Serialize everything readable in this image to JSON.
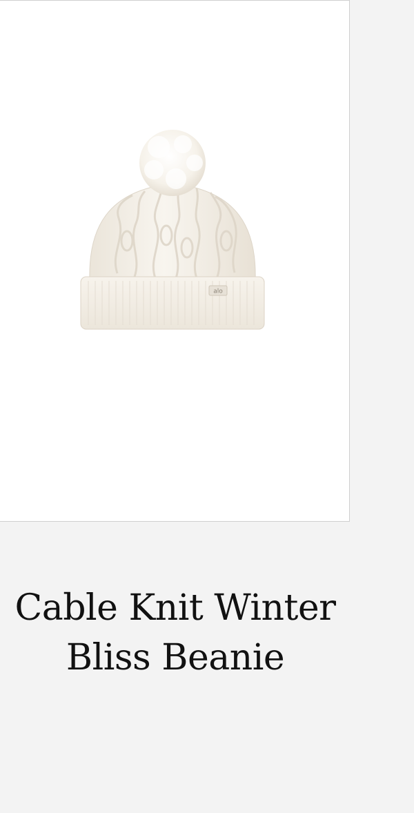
{
  "product": {
    "title_line_1": "Cable Knit Winter",
    "title_line_2": "Bliss Beanie",
    "image_logo_text": "alo"
  },
  "colors": {
    "page_background": "#f3f3f3",
    "image_background": "#ffffff",
    "beanie_color": "#f4f0e8",
    "title_text": "#111111"
  }
}
